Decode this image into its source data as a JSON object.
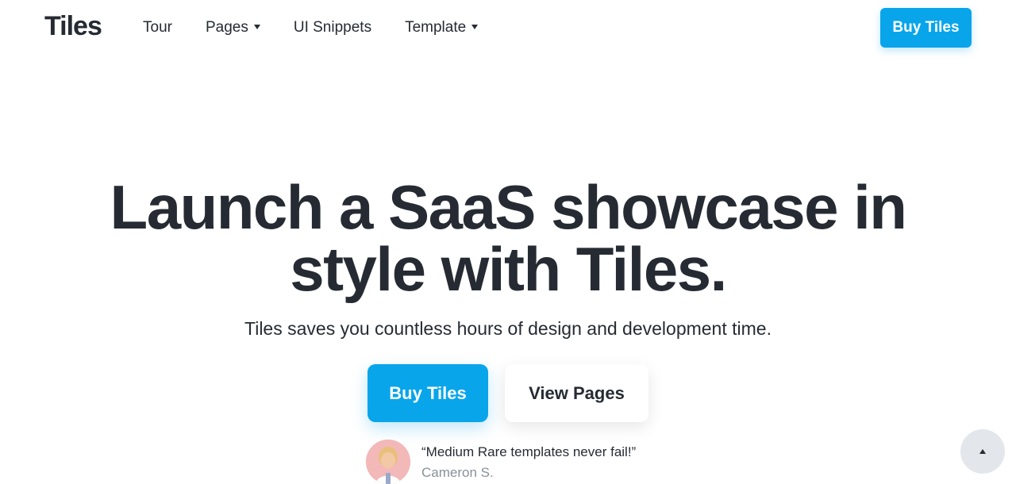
{
  "brand": {
    "logo_text": "Tiles"
  },
  "nav": {
    "items": [
      {
        "label": "Tour",
        "has_dropdown": false
      },
      {
        "label": "Pages",
        "has_dropdown": true
      },
      {
        "label": "UI Snippets",
        "has_dropdown": false
      },
      {
        "label": "Template",
        "has_dropdown": true
      }
    ],
    "cta_label": "Buy Tiles"
  },
  "hero": {
    "title_line1": "Launch a SaaS showcase in",
    "title_line2": "style with Tiles.",
    "subtitle": "Tiles saves you countless hours of design and development time.",
    "primary_cta": "Buy Tiles",
    "secondary_cta": "View Pages"
  },
  "testimonial": {
    "quote": "“Medium Rare templates never fail!”",
    "author": "Cameron S."
  },
  "colors": {
    "accent": "#08a5eb",
    "text": "#262b33",
    "muted": "#8a9099",
    "scroll_button_bg": "#e3e6ea"
  },
  "icons": {
    "dropdown": "caret-down-icon",
    "scroll_top": "caret-up-icon",
    "avatar": "avatar-image"
  }
}
